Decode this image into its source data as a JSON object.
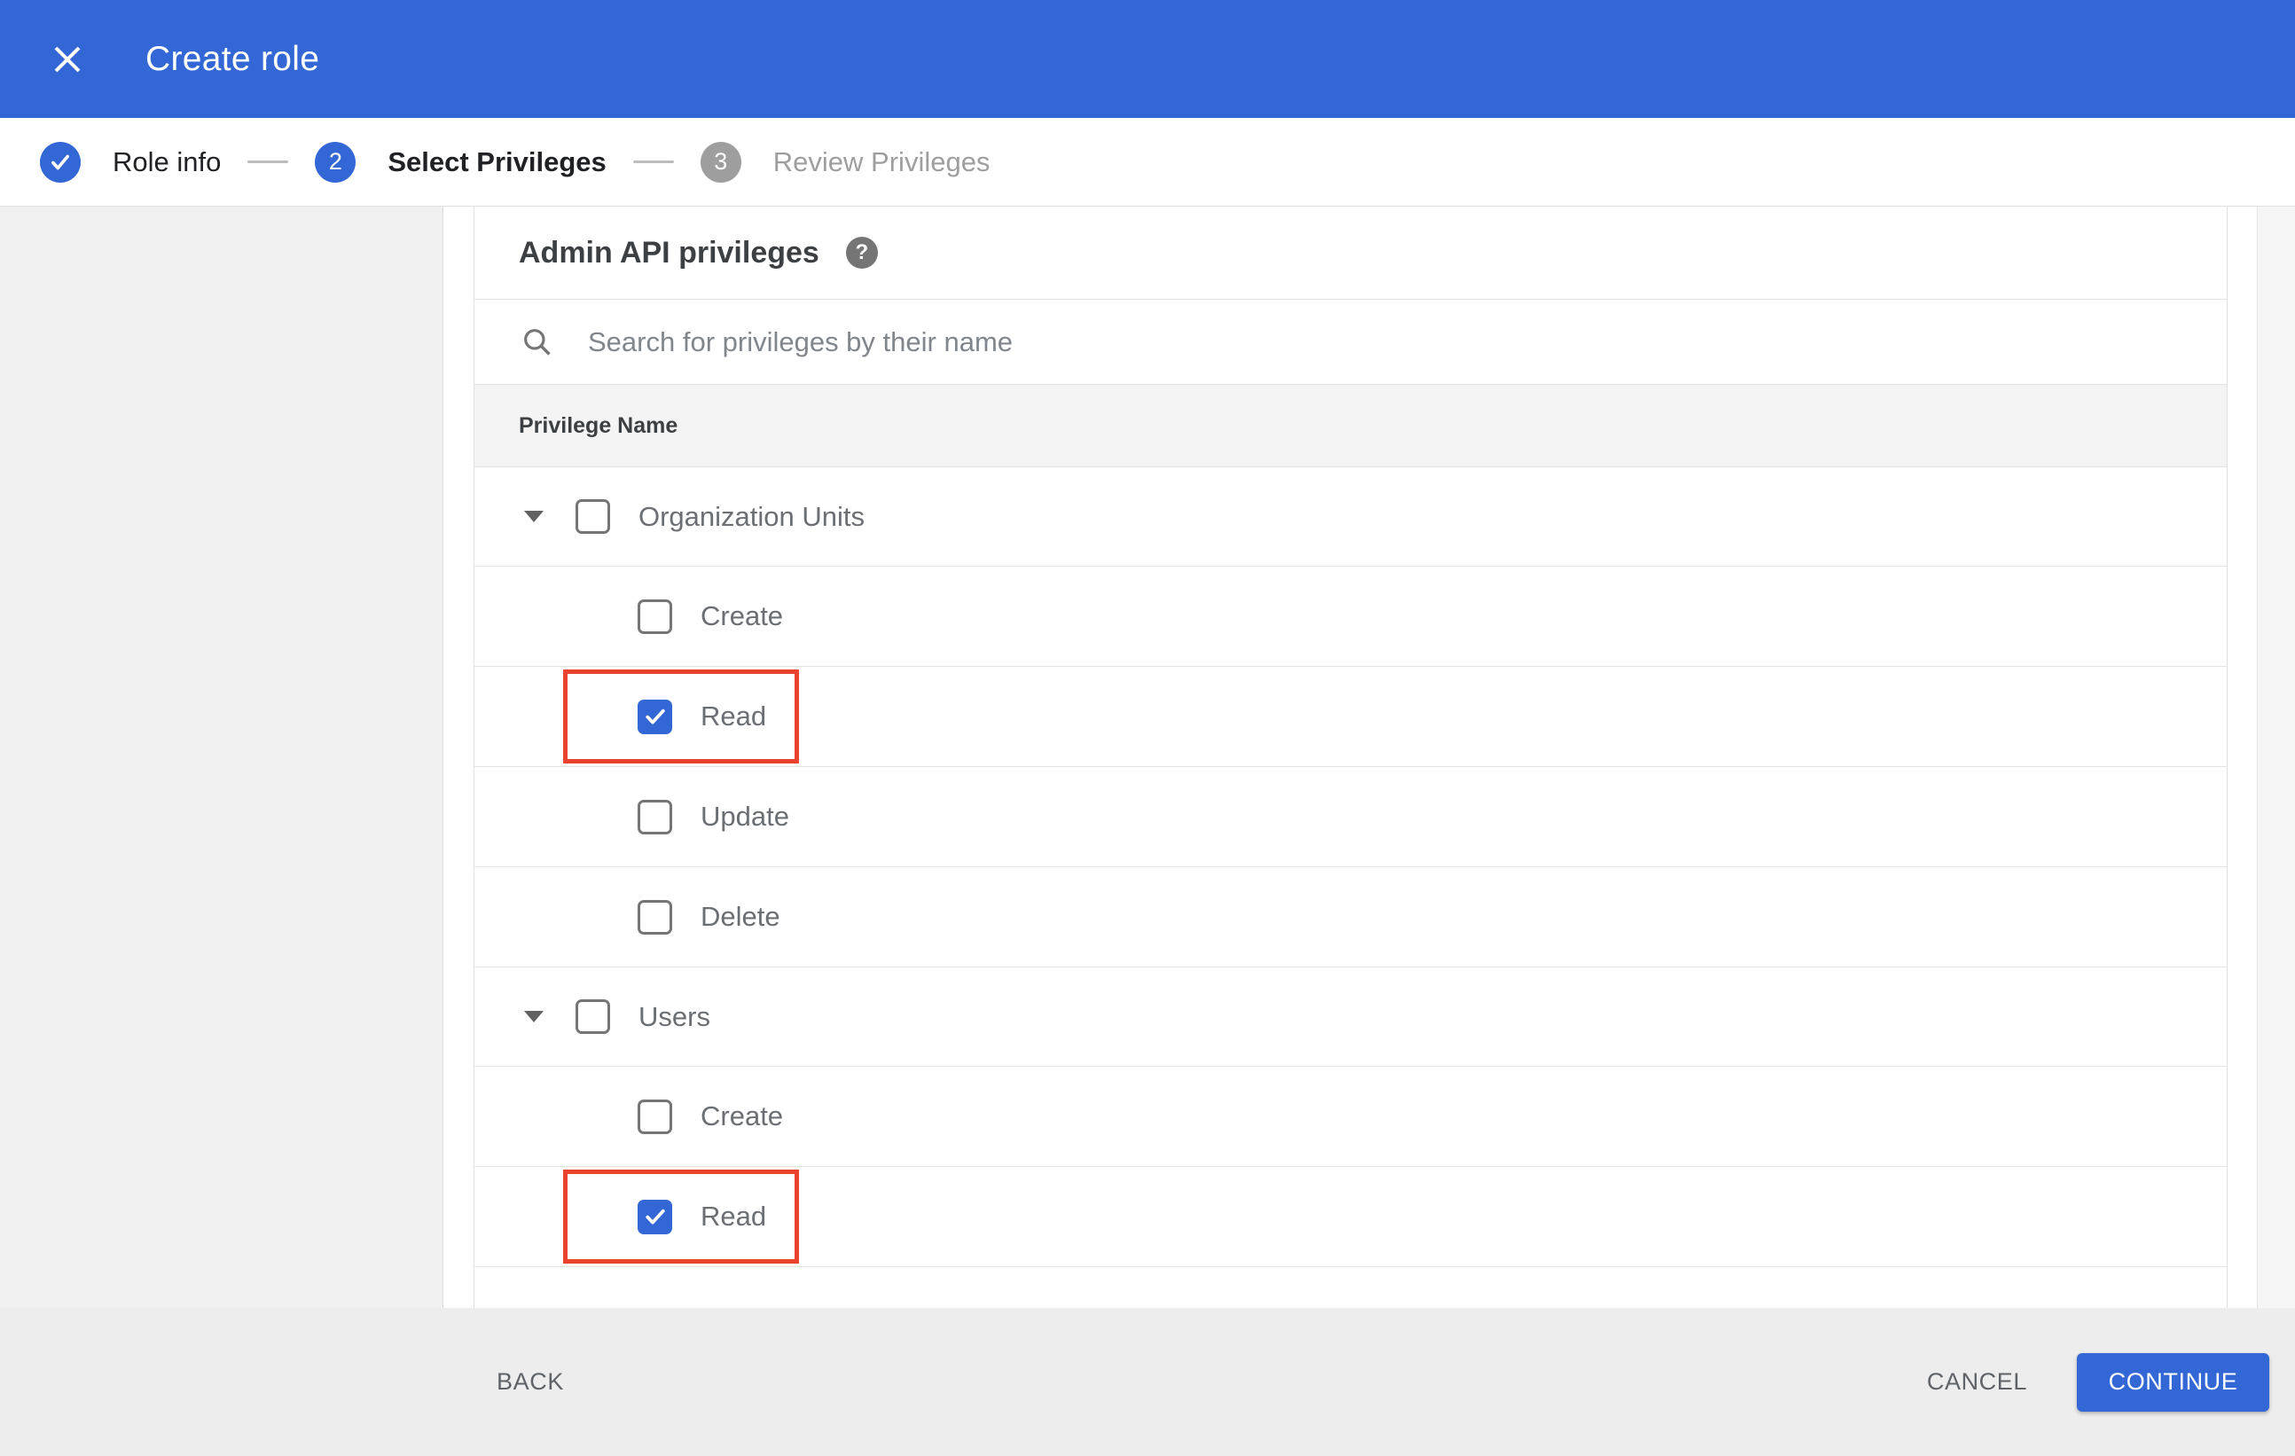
{
  "colors": {
    "accent": "#3367d6",
    "highlight": "#e8432d",
    "appbar": "#3367d6"
  },
  "header": {
    "title": "Create role"
  },
  "stepper": {
    "steps": [
      {
        "label": "Role info",
        "status": "complete"
      },
      {
        "label": "Select Privileges",
        "status": "active",
        "number": "2"
      },
      {
        "label": "Review Privileges",
        "status": "inactive",
        "number": "3"
      }
    ]
  },
  "panel": {
    "heading": "Admin API privileges",
    "help_icon": "?",
    "search": {
      "placeholder": "Search for privileges by their name"
    },
    "table_header": "Privilege Name",
    "groups": [
      {
        "label": "Organization Units",
        "checked": false,
        "expanded": true,
        "children": [
          {
            "label": "Create",
            "checked": false,
            "highlight": false
          },
          {
            "label": "Read",
            "checked": true,
            "highlight": true
          },
          {
            "label": "Update",
            "checked": false,
            "highlight": false
          },
          {
            "label": "Delete",
            "checked": false,
            "highlight": false
          }
        ]
      },
      {
        "label": "Users",
        "checked": false,
        "expanded": true,
        "children": [
          {
            "label": "Create",
            "checked": false,
            "highlight": false
          },
          {
            "label": "Read",
            "checked": true,
            "highlight": true
          }
        ]
      }
    ]
  },
  "footer": {
    "back": "BACK",
    "cancel": "CANCEL",
    "continue": "CONTINUE"
  }
}
